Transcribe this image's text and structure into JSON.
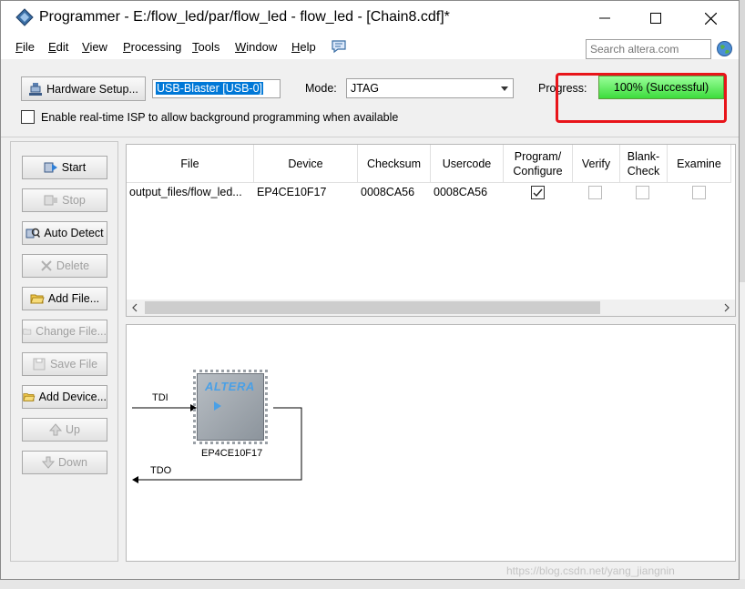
{
  "window": {
    "title": "Programmer - E:/flow_led/par/flow_led - flow_led - [Chain8.cdf]*"
  },
  "menu": {
    "items": [
      {
        "hot": "F",
        "rest": "ile"
      },
      {
        "hot": "E",
        "rest": "dit"
      },
      {
        "hot": "V",
        "rest": "iew"
      },
      {
        "hot": "P",
        "rest": "rocessing"
      },
      {
        "hot": "T",
        "rest": "ools"
      },
      {
        "hot": "W",
        "rest": "indow"
      },
      {
        "hot": "H",
        "rest": "elp"
      }
    ],
    "search_placeholder": "Search altera.com"
  },
  "toolbar": {
    "hardware_setup": "Hardware Setup...",
    "hardware_value": "USB-Blaster [USB-0]",
    "mode_label": "Mode:",
    "mode_value": "JTAG",
    "progress_label": "Progress:",
    "progress_text": "100% (Successful)",
    "progress_fraction": 1.0,
    "isp_label": "Enable real-time ISP to allow background programming when available",
    "isp_checked": false
  },
  "side_buttons": [
    {
      "label": "Start",
      "enabled": true
    },
    {
      "label": "Stop",
      "enabled": false
    },
    {
      "label": "Auto Detect",
      "enabled": true
    },
    {
      "label": "Delete",
      "enabled": false
    },
    {
      "label": "Add File...",
      "enabled": true
    },
    {
      "label": "Change File...",
      "enabled": false
    },
    {
      "label": "Save File",
      "enabled": false
    },
    {
      "label": "Add Device...",
      "enabled": true
    },
    {
      "label": "Up",
      "enabled": false
    },
    {
      "label": "Down",
      "enabled": false
    }
  ],
  "table": {
    "headers": [
      "File",
      "Device",
      "Checksum",
      "Usercode",
      "Program/\nConfigure",
      "Verify",
      "Blank-\nCheck",
      "Examine"
    ],
    "rows": [
      {
        "file": "output_files/flow_led...",
        "device": "EP4CE10F17",
        "checksum": "0008CA56",
        "usercode": "0008CA56",
        "program": true,
        "verify": false,
        "blank_check": false,
        "examine": false
      }
    ]
  },
  "chain": {
    "tdi": "TDI",
    "tdo": "TDO",
    "chip_logo": "ALTERA",
    "chip_name": "EP4CE10F17"
  },
  "watermark": "https://blog.csdn.net/yang_jiangnin",
  "colors": {
    "progress_green": "#3cdc3c",
    "highlight_red": "#e8141a",
    "selection_blue": "#0078d7"
  }
}
